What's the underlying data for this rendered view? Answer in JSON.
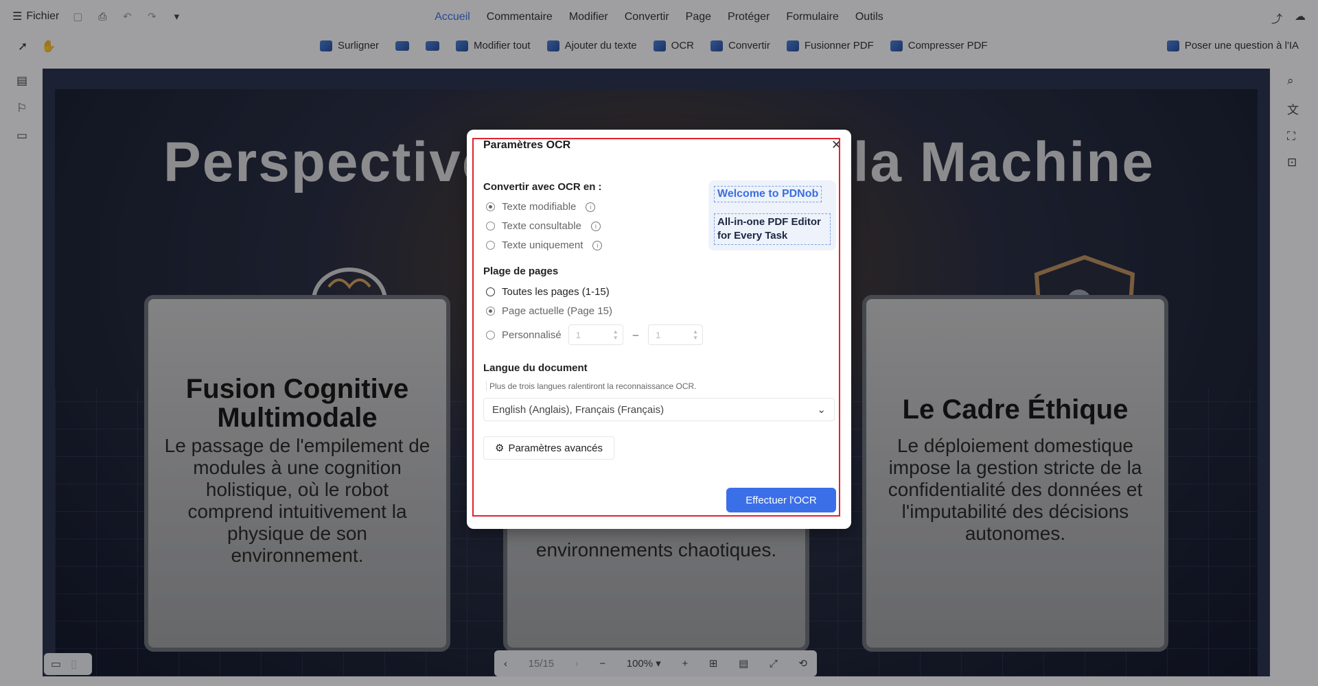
{
  "menubar": {
    "file_label": "Fichier",
    "menus": [
      "Accueil",
      "Commentaire",
      "Modifier",
      "Convertir",
      "Page",
      "Protéger",
      "Formulaire",
      "Outils"
    ],
    "active_menu": "Accueil"
  },
  "toolbar": {
    "highlight": "Surligner",
    "edit_all": "Modifier tout",
    "add_text": "Ajouter du texte",
    "ocr": "OCR",
    "convert": "Convertir",
    "merge": "Fusionner PDF",
    "compress": "Compresser PDF",
    "ask_ai": "Poser une question à l'IA"
  },
  "document": {
    "title_left": "Perspective",
    "title_right": "la Machine",
    "panel_left": {
      "title": "Fusion Cognitive Multimodale",
      "body": "Le passage de l'empilement de modules à une cognition holistique, où le robot comprend intuitivement la physique de son environnement."
    },
    "panel_middle": {
      "body": "environnements chaotiques."
    },
    "panel_right": {
      "title": "Le Cadre Éthique",
      "body": "Le déploiement domestique impose la gestion stricte de la confidentialité des données et l'imputabilité des décisions autonomes."
    }
  },
  "bottom_nav": {
    "page_indicator": "15/15",
    "zoom": "100%"
  },
  "modal": {
    "title": "Paramètres OCR",
    "convert_label": "Convertir avec OCR en :",
    "convert_options": [
      "Texte modifiable",
      "Texte consultable",
      "Texte uniquement"
    ],
    "convert_selected": 0,
    "page_range_label": "Plage de pages",
    "page_options": [
      "Toutes les pages (1-15)",
      "Page actuelle (Page 15)",
      "Personnalisé"
    ],
    "page_selected": 1,
    "custom_from": "1",
    "custom_to": "1",
    "language_label": "Langue du document",
    "language_hint": "Plus de trois langues ralentiront la reconnaissance OCR.",
    "language_value": "English (Anglais), Français (Français)",
    "advanced_button": "Paramètres avancés",
    "primary_button": "Effectuer l'OCR",
    "promo_line1": "Welcome to PDNob",
    "promo_line2": "All-in-one PDF Editor for Every Task"
  },
  "colors": {
    "accent": "#3b6fe8",
    "highlight_border": "#e0222e"
  }
}
